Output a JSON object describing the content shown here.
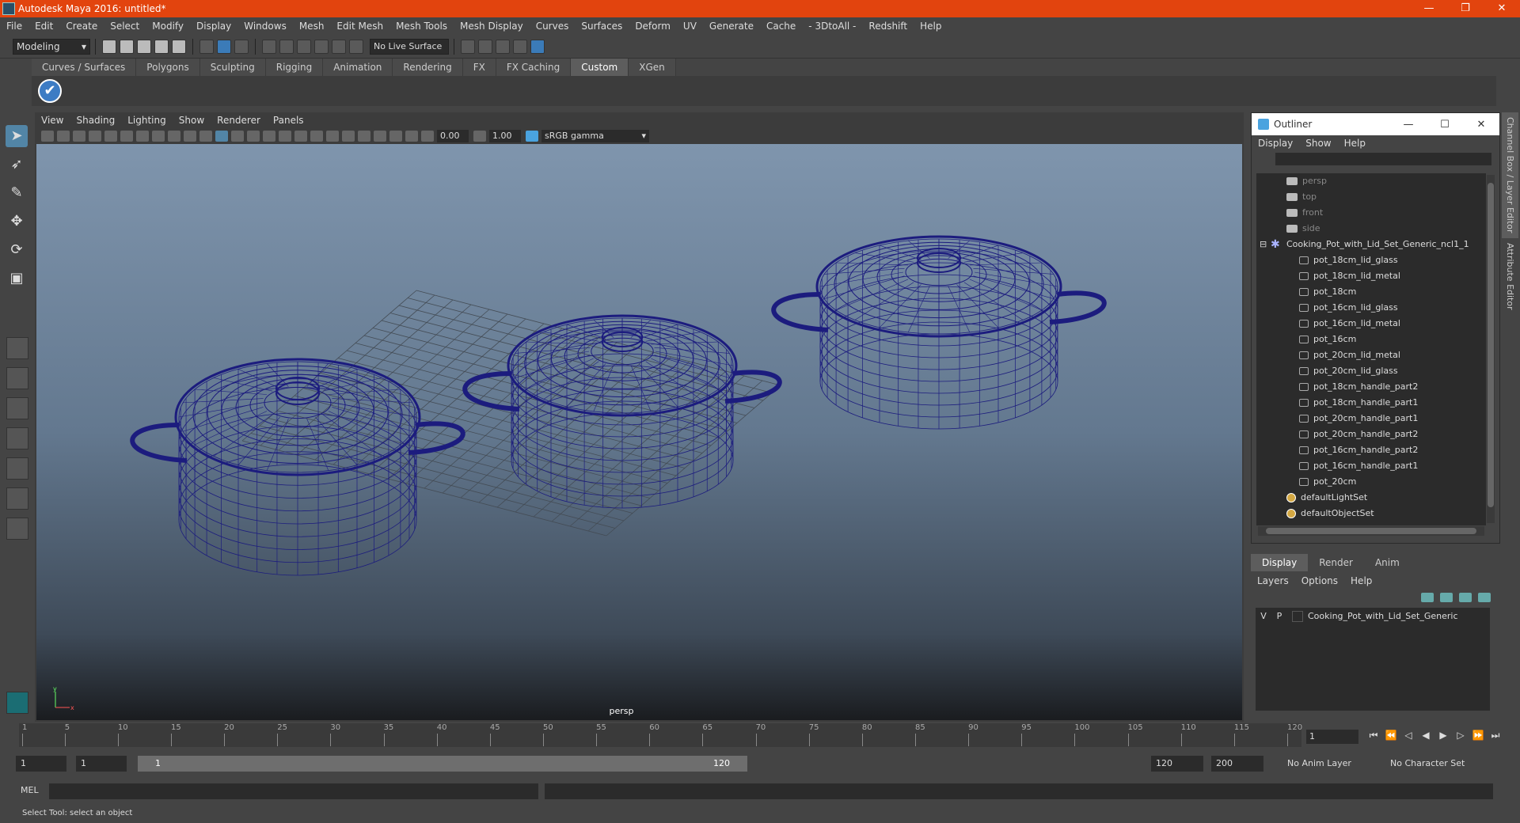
{
  "window": {
    "title": "Autodesk Maya 2016: untitled*",
    "minimize": "—",
    "maximize": "❐",
    "close": "✕"
  },
  "menubar": [
    "File",
    "Edit",
    "Create",
    "Select",
    "Modify",
    "Display",
    "Windows",
    "Mesh",
    "Edit Mesh",
    "Mesh Tools",
    "Mesh Display",
    "Curves",
    "Surfaces",
    "Deform",
    "UV",
    "Generate",
    "Cache",
    "- 3DtoAll -",
    "Redshift",
    "Help"
  ],
  "statusline": {
    "mode": "Modeling",
    "live_surface": "No Live Surface"
  },
  "shelf": {
    "tabs": [
      "Curves / Surfaces",
      "Polygons",
      "Sculpting",
      "Rigging",
      "Animation",
      "Rendering",
      "FX",
      "FX Caching",
      "Custom",
      "XGen"
    ],
    "active": "Custom",
    "check_glyph": "✔"
  },
  "viewport": {
    "menu": [
      "View",
      "Shading",
      "Lighting",
      "Show",
      "Renderer",
      "Panels"
    ],
    "exposure": "0.00",
    "gamma_value": "1.00",
    "color_space": "sRGB gamma",
    "camera_label": "persp",
    "wire_color": "#1c1c7e",
    "axis_x": "x",
    "axis_y": "y"
  },
  "outliner": {
    "title": "Outliner",
    "menu": [
      "Display",
      "Show",
      "Help"
    ],
    "rows": [
      {
        "label": "persp",
        "kind": "camera",
        "indent": 0
      },
      {
        "label": "top",
        "kind": "camera",
        "indent": 0
      },
      {
        "label": "front",
        "kind": "camera",
        "indent": 0
      },
      {
        "label": "side",
        "kind": "camera",
        "indent": 0
      },
      {
        "label": "Cooking_Pot_with_Lid_Set_Generic_ncl1_1",
        "kind": "group",
        "indent": 0
      },
      {
        "label": "pot_18cm_lid_glass",
        "kind": "mesh",
        "indent": 1
      },
      {
        "label": "pot_18cm_lid_metal",
        "kind": "mesh",
        "indent": 1
      },
      {
        "label": "pot_18cm",
        "kind": "mesh",
        "indent": 1
      },
      {
        "label": "pot_16cm_lid_glass",
        "kind": "mesh",
        "indent": 1
      },
      {
        "label": "pot_16cm_lid_metal",
        "kind": "mesh",
        "indent": 1
      },
      {
        "label": "pot_16cm",
        "kind": "mesh",
        "indent": 1
      },
      {
        "label": "pot_20cm_lid_metal",
        "kind": "mesh",
        "indent": 1
      },
      {
        "label": "pot_20cm_lid_glass",
        "kind": "mesh",
        "indent": 1
      },
      {
        "label": "pot_18cm_handle_part2",
        "kind": "mesh",
        "indent": 1
      },
      {
        "label": "pot_18cm_handle_part1",
        "kind": "mesh",
        "indent": 1
      },
      {
        "label": "pot_20cm_handle_part1",
        "kind": "mesh",
        "indent": 1
      },
      {
        "label": "pot_20cm_handle_part2",
        "kind": "mesh",
        "indent": 1
      },
      {
        "label": "pot_16cm_handle_part2",
        "kind": "mesh",
        "indent": 1
      },
      {
        "label": "pot_16cm_handle_part1",
        "kind": "mesh",
        "indent": 1
      },
      {
        "label": "pot_20cm",
        "kind": "mesh",
        "indent": 1
      },
      {
        "label": "defaultLightSet",
        "kind": "set",
        "indent": 0
      },
      {
        "label": "defaultObjectSet",
        "kind": "set",
        "indent": 0
      }
    ]
  },
  "layer_editor": {
    "tabs": [
      "Display",
      "Render",
      "Anim"
    ],
    "active_tab": "Display",
    "menu": [
      "Layers",
      "Options",
      "Help"
    ],
    "layer": {
      "v": "V",
      "p": "P",
      "name": "Cooking_Pot_with_Lid_Set_Generic"
    }
  },
  "side_tabs": [
    "Channel Box / Layer Editor",
    "Attribute Editor"
  ],
  "timeline": {
    "ticks": [
      1,
      5,
      10,
      15,
      20,
      25,
      30,
      35,
      40,
      45,
      50,
      55,
      60,
      65,
      70,
      75,
      80,
      85,
      90,
      95,
      100,
      105,
      110,
      115,
      120
    ],
    "current_frame": "1"
  },
  "range": {
    "start": "1",
    "playback_start": "1",
    "bar_start": "1",
    "bar_end": "120",
    "playback_end": "120",
    "end": "200",
    "anim_layer": "No Anim Layer",
    "char_set": "No Character Set"
  },
  "command_line": {
    "label": "MEL"
  },
  "help_line": "Select Tool: select an object"
}
